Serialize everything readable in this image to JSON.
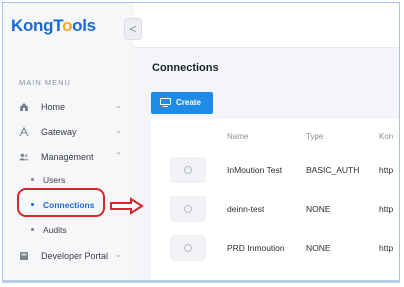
{
  "app": {
    "logo_part1": "Kong",
    "logo_part2": "T",
    "logo_part3": "o",
    "logo_part4": "ols",
    "collapse_glyph": "<"
  },
  "sidebar": {
    "menu_title": "MAIN MENU",
    "items": [
      {
        "label": "Home",
        "icon": "home-icon",
        "expanded": false
      },
      {
        "label": "Gateway",
        "icon": "gateway-icon",
        "expanded": false
      },
      {
        "label": "Management",
        "icon": "users-icon",
        "expanded": true
      },
      {
        "label": "Developer Portal",
        "icon": "portal-icon",
        "expanded": false
      }
    ],
    "sub_items": [
      {
        "label": "Users",
        "active": false
      },
      {
        "label": "Connections",
        "active": true
      },
      {
        "label": "Audits",
        "active": false
      }
    ],
    "chevron_down": "⌄",
    "chevron_up": "⌃"
  },
  "main": {
    "title": "Connections",
    "create_label": "Create",
    "columns": [
      "Name",
      "Type",
      "Kon"
    ],
    "rows": [
      {
        "name": "InMoution Test",
        "type": "BASIC_AUTH",
        "kong": "http"
      },
      {
        "name": "deinn-test",
        "type": "NONE",
        "kong": "http"
      },
      {
        "name": "PRD Inmoution",
        "type": "NONE",
        "kong": "http"
      }
    ]
  },
  "colors": {
    "accent": "#1e8ce6",
    "brand_blue": "#1a6ad9",
    "brand_orange": "#f5a623",
    "annotation_red": "#d9262c"
  }
}
